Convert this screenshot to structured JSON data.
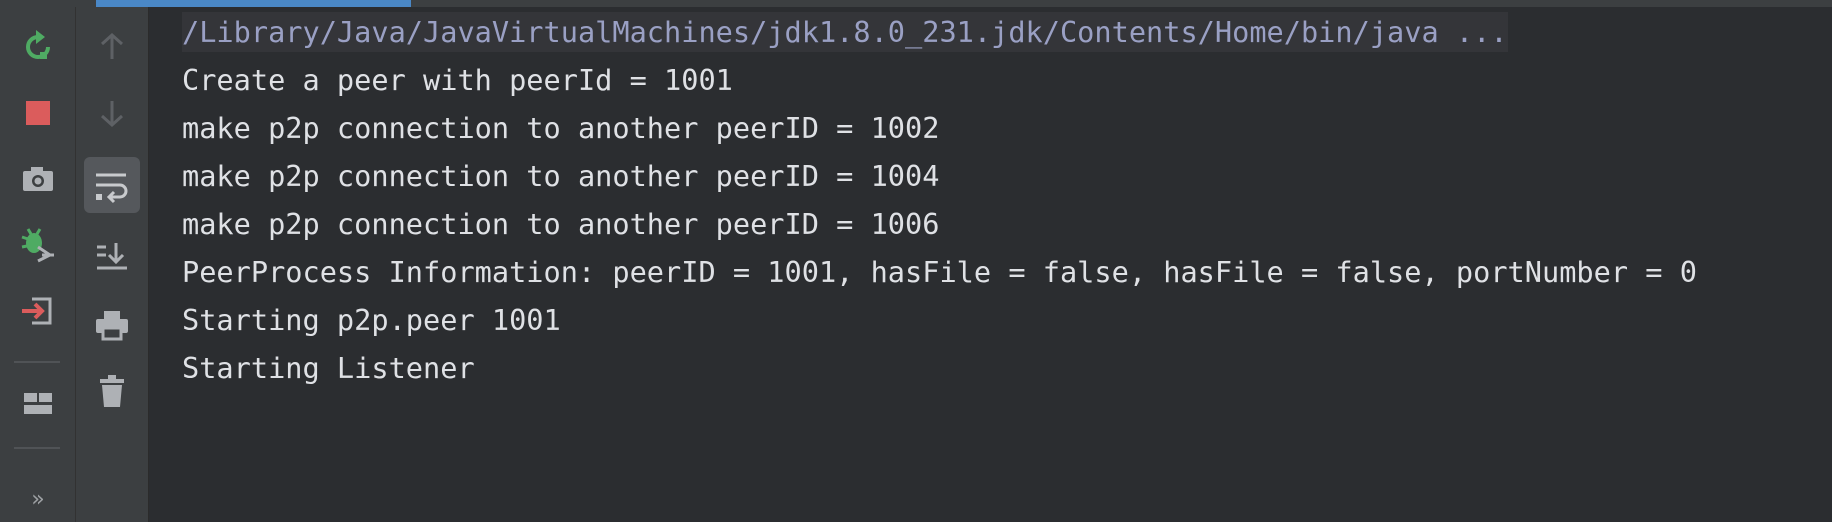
{
  "colors": {
    "background": "#2b2d30",
    "toolbar": "#3c3f41",
    "accent": "#4a88c7",
    "console_text": "#dfe1e5",
    "command_text": "#9aa0c4",
    "rerun_green": "#4fab63",
    "stop_red": "#db5c5c",
    "icon_gray": "#aeb1b5"
  },
  "toolbar_left": {
    "buttons": [
      {
        "icon": "rerun-icon"
      },
      {
        "icon": "stop-icon"
      },
      {
        "icon": "camera-icon"
      },
      {
        "icon": "debug-settings-icon"
      },
      {
        "icon": "exit-icon"
      },
      {
        "icon": "layout-icon"
      }
    ],
    "more": "»"
  },
  "toolbar_right": {
    "buttons": [
      {
        "icon": "arrow-up-icon"
      },
      {
        "icon": "arrow-down-icon"
      },
      {
        "icon": "soft-wrap-icon",
        "toggled": true
      },
      {
        "icon": "scroll-to-end-icon"
      },
      {
        "icon": "print-icon"
      },
      {
        "icon": "trash-icon"
      }
    ]
  },
  "console": {
    "command": "/Library/Java/JavaVirtualMachines/jdk1.8.0_231.jdk/Contents/Home/bin/java ...",
    "lines": [
      "Create a peer with peerId = 1001",
      "make p2p connection to another peerID = 1002",
      "make p2p connection to another peerID = 1004",
      "make p2p connection to another peerID = 1006",
      "PeerProcess Information: peerID = 1001, hasFile = false, hasFile = false, portNumber = 0",
      "Starting p2p.peer 1001",
      "Starting Listener"
    ]
  }
}
